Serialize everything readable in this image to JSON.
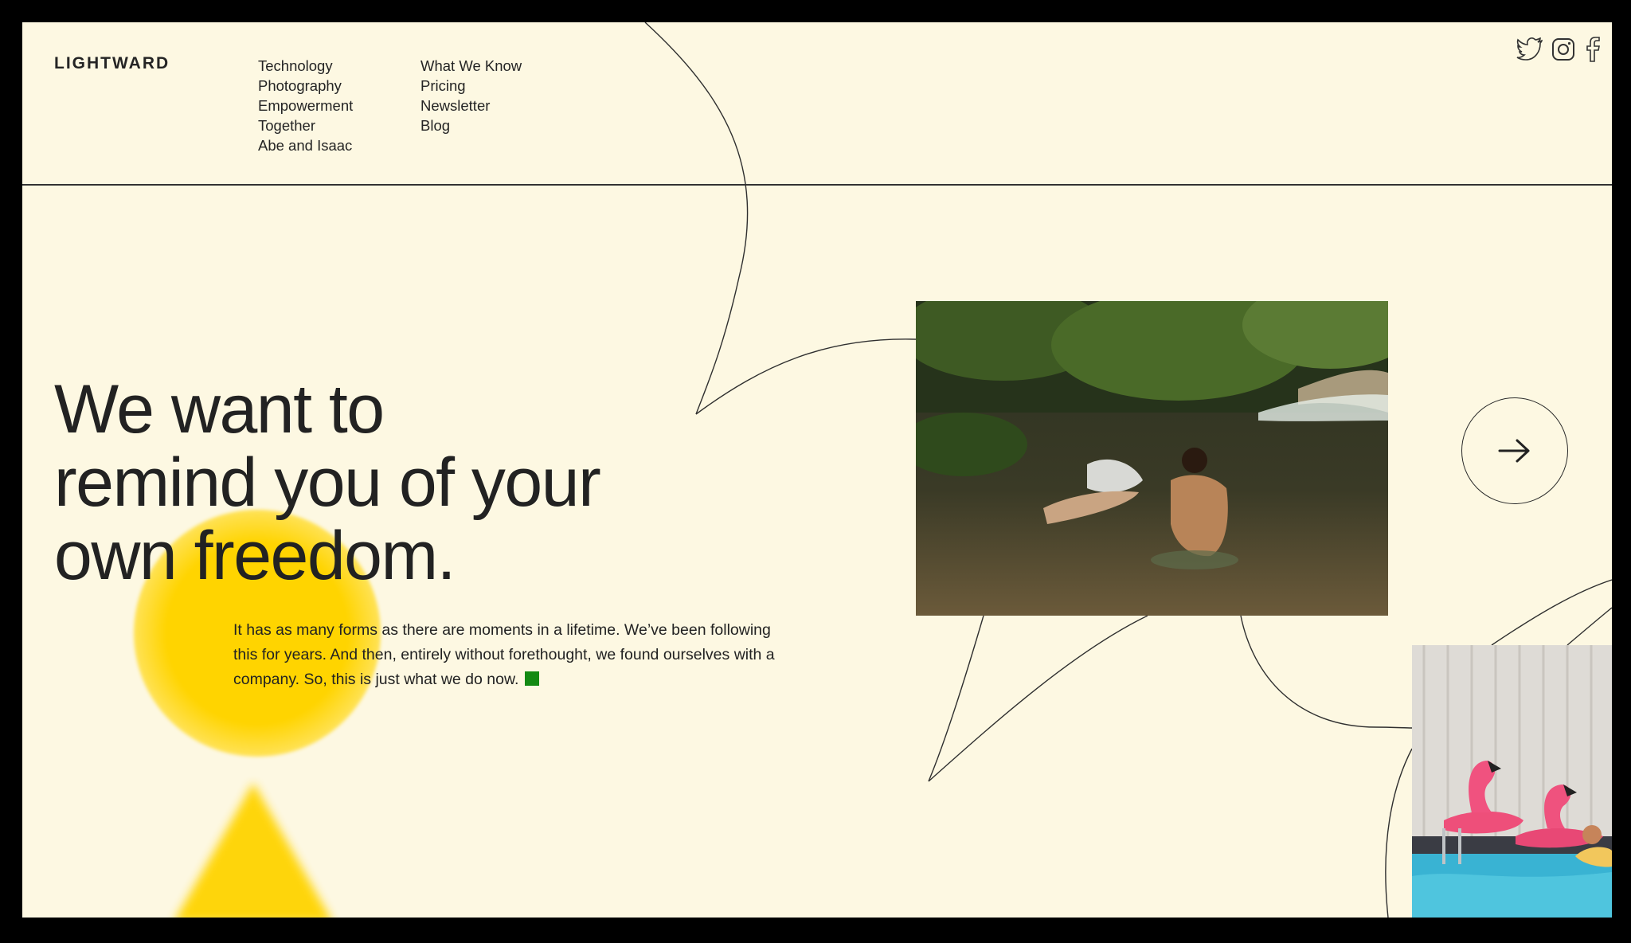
{
  "brand": {
    "logo_text": "LIGHTWARD"
  },
  "nav": {
    "column1": [
      "Technology",
      "Photography",
      "Empowerment",
      "Together",
      "Abe and Isaac"
    ],
    "column2": [
      "What We Know",
      "Pricing",
      "Newsletter",
      "Blog"
    ]
  },
  "social": [
    "twitter-icon",
    "instagram-icon",
    "facebook-icon"
  ],
  "hero": {
    "headline_lines": [
      "We want to",
      "remind you of your",
      "own freedom."
    ],
    "body": "It has as many forms as there are moments in a lifetime. We’ve been following this for years. And then, entirely without forethought, we found ourselves with a company. So, this is just what we do now."
  },
  "controls": {
    "next_icon": "arrow-right-icon"
  },
  "colors": {
    "background": "#fdf8e2",
    "accent_yellow": "#ffd400",
    "stop_square": "#138a13",
    "text": "#222222"
  }
}
